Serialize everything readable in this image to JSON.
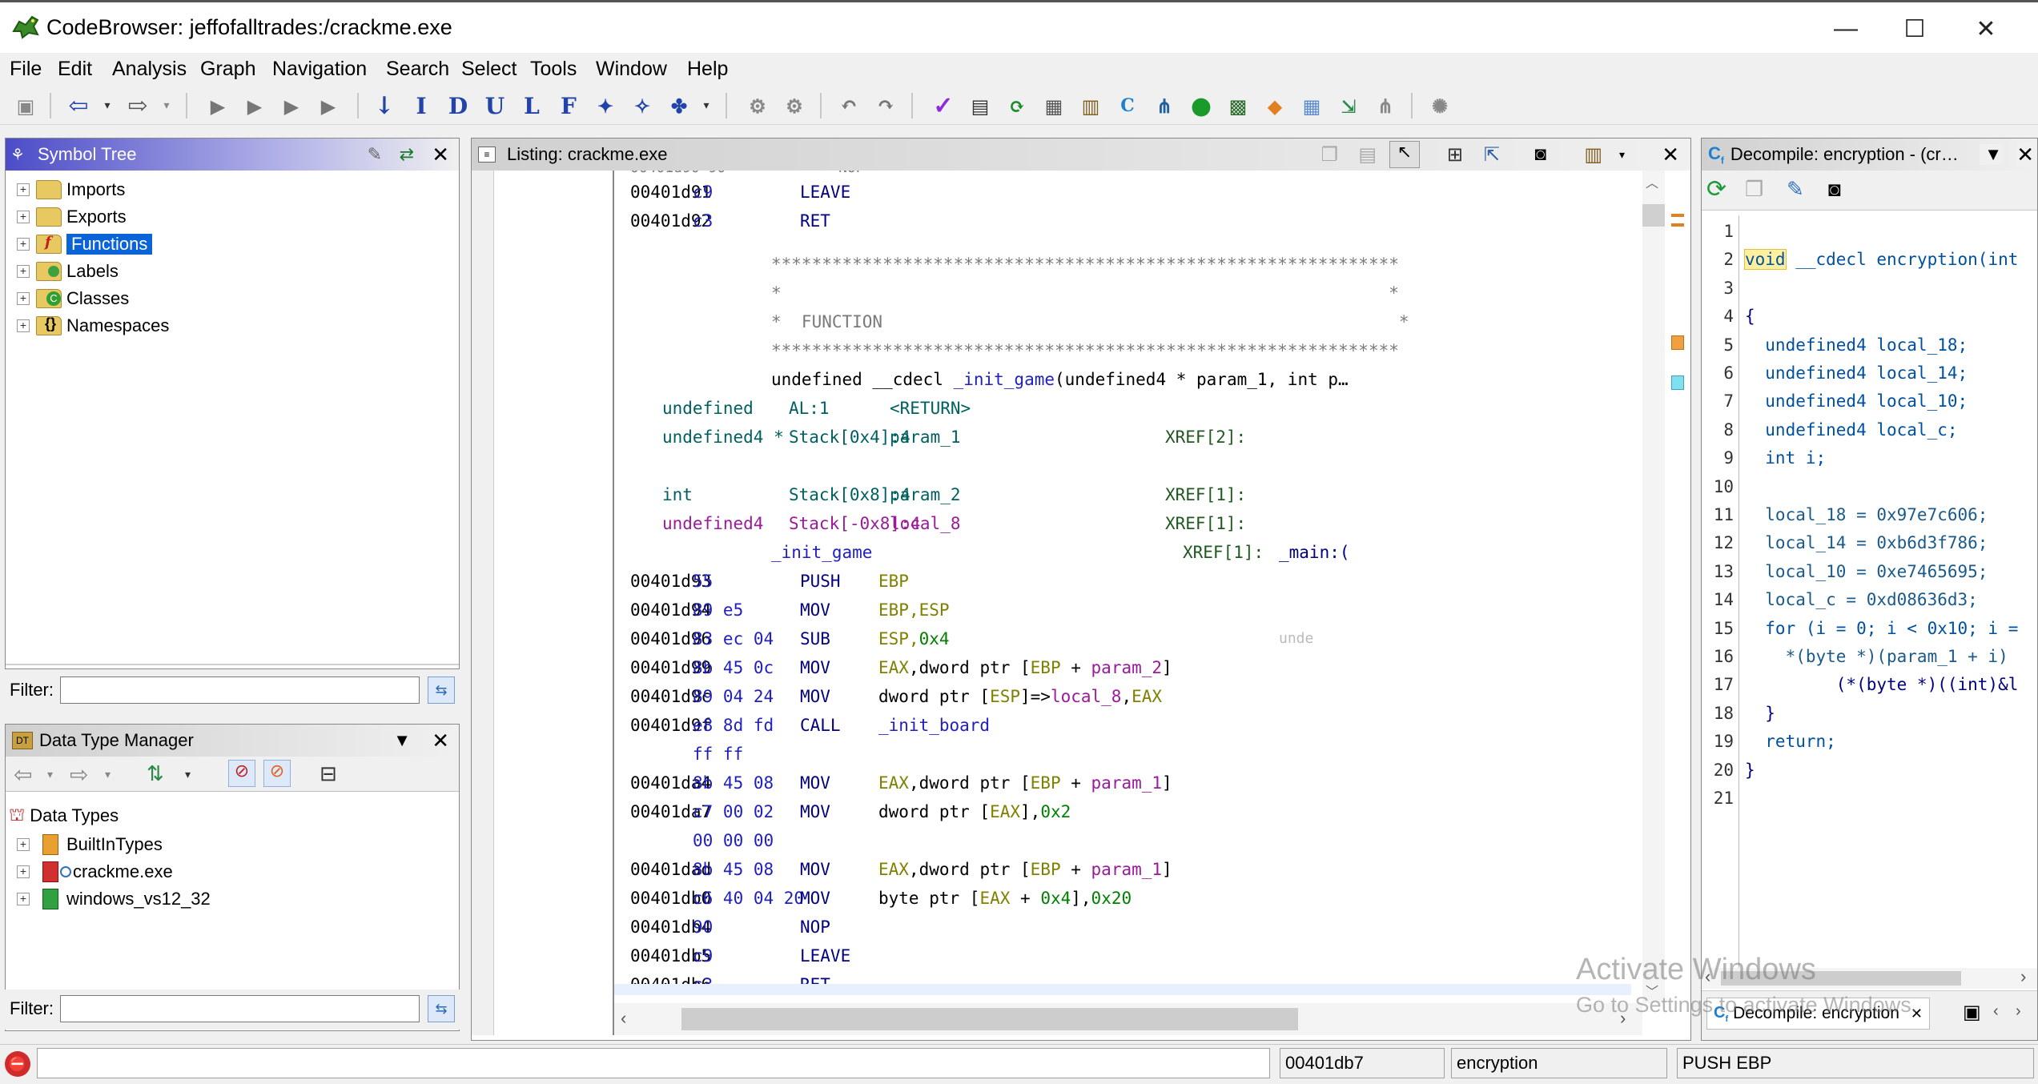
{
  "window": {
    "title": "CodeBrowser: jeffofalltrades:/crackme.exe",
    "minimize": "—",
    "maximize": "☐",
    "close": "✕"
  },
  "menu": [
    "File",
    "Edit",
    "Analysis",
    "Graph",
    "Navigation",
    "Search",
    "Select",
    "Tools",
    "Window",
    "Help"
  ],
  "toolbar": {
    "letters": [
      "I",
      "D",
      "U",
      "L",
      "F"
    ]
  },
  "symbol_tree": {
    "title": "Symbol Tree",
    "items": [
      "Imports",
      "Exports",
      "Functions",
      "Labels",
      "Classes",
      "Namespaces"
    ],
    "selected": "Functions",
    "filter_label": "Filter:"
  },
  "data_type_manager": {
    "title": "Data Type Manager",
    "root": "Data Types",
    "items": [
      "BuiltInTypes",
      "crackme.exe",
      "windows_vs12_32"
    ],
    "filter_label": "Filter:"
  },
  "listing": {
    "title": "Listing:  crackme.exe",
    "rows": [
      {
        "addr": "00401d91",
        "bytes": "c9",
        "mnem": "LEAVE",
        "ops": ""
      },
      {
        "addr": "00401d92",
        "bytes": "c3",
        "mnem": "RET",
        "ops": ""
      }
    ],
    "stars": "**************************************************************",
    "star_edge": "*                                                            *",
    "function_banner": "*  FUNCTION                                                   *",
    "signature_prefix": "undefined __cdecl ",
    "signature_name": "_init_game",
    "signature_rest": "(undefined4 * param_1, int p…",
    "vars": [
      {
        "type": "undefined",
        "storage": "AL:1",
        "name": "<RETURN>",
        "xref": ""
      },
      {
        "type": "undefined4 *",
        "storage": "Stack[0x4]:4",
        "name": "param_1",
        "xref": "XREF[2]:"
      },
      {
        "type": "int",
        "storage": "Stack[0x8]:4",
        "name": "param_2",
        "xref": "XREF[1]:"
      },
      {
        "type": "undefined4",
        "storage": "Stack[-0x8]:4",
        "name": "local_8",
        "xref": "XREF[1]:"
      }
    ],
    "label": "_init_game",
    "label_xref": "XREF[1]:",
    "label_xref_target": "_main:(",
    "code": [
      {
        "addr": "00401d93",
        "bytes": "55",
        "mnem": "PUSH",
        "ops": "EBP"
      },
      {
        "addr": "00401d94",
        "bytes": "89 e5",
        "mnem": "MOV",
        "ops": "EBP,ESP"
      },
      {
        "addr": "00401d96",
        "bytes": "83 ec 04",
        "mnem": "SUB",
        "ops": "ESP,0x4"
      },
      {
        "addr": "00401d99",
        "bytes": "8b 45 0c",
        "mnem": "MOV",
        "ops": "EAX,dword ptr [EBP + param_2]"
      },
      {
        "addr": "00401d9c",
        "bytes": "89 04 24",
        "mnem": "MOV",
        "ops": "dword ptr [ESP]=>local_8,EAX"
      },
      {
        "addr": "00401d9f",
        "bytes": "e8 8d fd",
        "mnem": "CALL",
        "ops": "_init_board"
      },
      {
        "addr": "",
        "bytes": "ff ff",
        "mnem": "",
        "ops": ""
      },
      {
        "addr": "00401da4",
        "bytes": "8b 45 08",
        "mnem": "MOV",
        "ops": "EAX,dword ptr [EBP + param_1]"
      },
      {
        "addr": "00401da7",
        "bytes": "c7 00 02",
        "mnem": "MOV",
        "ops": "dword ptr [EAX],0x2"
      },
      {
        "addr": "",
        "bytes": "00 00 00",
        "mnem": "",
        "ops": ""
      },
      {
        "addr": "00401dad",
        "bytes": "8b 45 08",
        "mnem": "MOV",
        "ops": "EAX,dword ptr [EBP + param_1]"
      },
      {
        "addr": "00401db0",
        "bytes": "c6 40 04 20",
        "mnem": "MOV",
        "ops": "byte ptr [EAX + 0x4],0x20"
      },
      {
        "addr": "00401db4",
        "bytes": "90",
        "mnem": "NOP",
        "ops": ""
      },
      {
        "addr": "00401db5",
        "bytes": "c9",
        "mnem": "LEAVE",
        "ops": ""
      },
      {
        "addr": "00401db6",
        "bytes": "c3",
        "mnem": "RET",
        "ops": ""
      }
    ],
    "call_comment": "unde"
  },
  "decompile": {
    "title": "Decompile: encryption -  (cr…",
    "tab_label": "Decompile: encryption",
    "lines": [
      "",
      "void __cdecl encryption(int",
      "",
      "{",
      "  undefined4 local_18;",
      "  undefined4 local_14;",
      "  undefined4 local_10;",
      "  undefined4 local_c;",
      "  int i;",
      "",
      "  local_18 = 0x97e7c606;",
      "  local_14 = 0xb6d3f786;",
      "  local_10 = 0xe7465695;",
      "  local_c = 0xd08636d3;",
      "  for (i = 0; i < 0x10; i =",
      "    *(byte *)(param_1 + i)",
      "         (*(byte *)((int)&l",
      "  }",
      "  return;",
      "}",
      ""
    ]
  },
  "status": {
    "address": "00401db7",
    "function": "encryption",
    "instruction": "PUSH EBP"
  },
  "watermark": {
    "line1": "Activate Windows",
    "line2": "Go to Settings to activate Windows."
  },
  "colors": {
    "accent": "#3a3ab8",
    "selection": "#0a64d8"
  }
}
